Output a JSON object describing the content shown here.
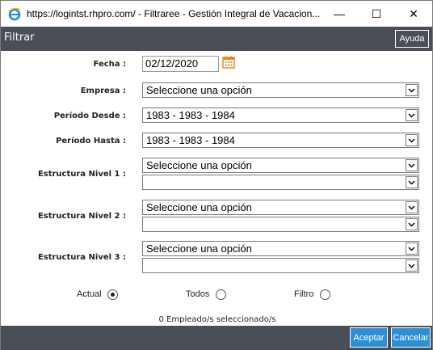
{
  "window": {
    "title": "https://logintst.rhpro.com/ - Filtraree - Gestión Integral de Vacacion...",
    "minimize_glyph": "—",
    "maximize_glyph": "☐",
    "close_glyph": "✕"
  },
  "dialog": {
    "title": "Filtrar",
    "help_label": "Ayuda"
  },
  "form": {
    "fecha_label": "Fecha :",
    "fecha_value": "02/12/2020",
    "empresa_label": "Empresa :",
    "empresa_value": "Seleccione una opción",
    "periodo_desde_label": "Período Desde :",
    "periodo_desde_value": "1983 - 1983 - 1984",
    "periodo_hasta_label": "Período Hasta :",
    "periodo_hasta_value": "1983 - 1983 - 1984",
    "nivel1_label": "Estructura Nivel 1 :",
    "nivel1_value": "Seleccione una opción",
    "nivel1_sub_value": "",
    "nivel2_label": "Estructura Nivel 2 :",
    "nivel2_value": "Seleccione una opción",
    "nivel2_sub_value": "",
    "nivel3_label": "Estructura Nivel 3 :",
    "nivel3_value": "Seleccione una opción",
    "nivel3_sub_value": ""
  },
  "radios": {
    "actual_label": "Actual",
    "todos_label": "Todos",
    "filtro_label": "Filtro",
    "selected": "Actual"
  },
  "status": {
    "count_text": "0 Empleado/s seleccionado/s"
  },
  "footer": {
    "accept_label": "Aceptar",
    "cancel_label": "Cancelar"
  },
  "colors": {
    "header_bg": "#4a4f57",
    "button_blue": "#2d8fd5",
    "calendar_orange": "#e8871e"
  },
  "icons": {
    "browser": "internet-explorer-icon",
    "calendar": "calendar-icon",
    "dropdown": "chevron-down-icon"
  }
}
